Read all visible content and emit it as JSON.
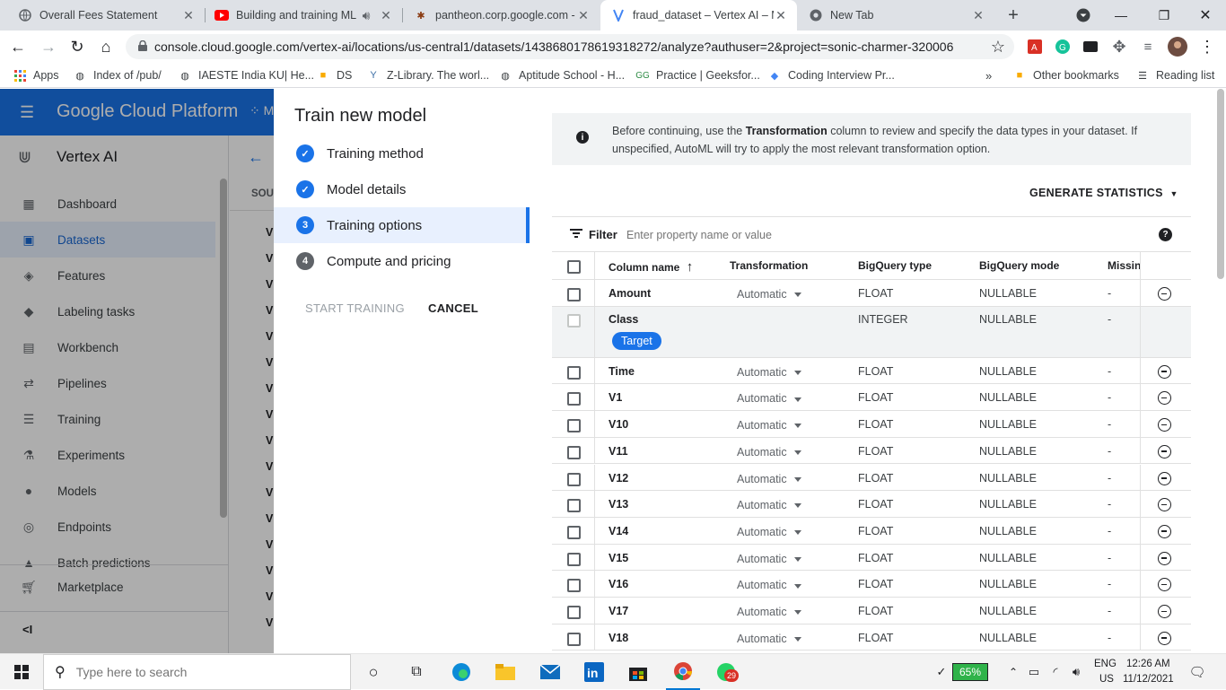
{
  "browser": {
    "tabs": [
      {
        "title": "Overall Fees Statement",
        "icon": "globe-icon"
      },
      {
        "title": "Building and training ML",
        "icon": "youtube-icon",
        "audio": true
      },
      {
        "title": "pantheon.corp.google.com -",
        "icon": "bug-icon"
      },
      {
        "title": "fraud_dataset – Vertex AI – M",
        "icon": "vertex-icon",
        "active": true
      },
      {
        "title": "New Tab",
        "icon": "chrome-icon"
      }
    ],
    "url": "console.cloud.google.com/vertex-ai/locations/us-central1/datasets/1438680178619318272/analyze?authuser=2&project=sonic-charmer-320006",
    "bookmarks": [
      {
        "label": "Apps"
      },
      {
        "label": "Index of /pub/"
      },
      {
        "label": "IAESTE India KU| He..."
      },
      {
        "label": "DS"
      },
      {
        "label": "Z-Library. The worl..."
      },
      {
        "label": "Aptitude School - H..."
      },
      {
        "label": "Practice | Geeksfor..."
      },
      {
        "label": "Coding Interview Pr..."
      },
      {
        "label": "»"
      },
      {
        "label": "Other bookmarks"
      },
      {
        "label": "Reading list"
      }
    ]
  },
  "console": {
    "product": "Google Cloud Platform",
    "project_initial": "M",
    "service": "Vertex AI",
    "nav": [
      {
        "label": "Dashboard",
        "icon": "dashboard-icon"
      },
      {
        "label": "Datasets",
        "icon": "datasets-icon",
        "selected": true
      },
      {
        "label": "Features",
        "icon": "features-icon"
      },
      {
        "label": "Labeling tasks",
        "icon": "label-icon"
      },
      {
        "label": "Workbench",
        "icon": "workbench-icon"
      },
      {
        "label": "Pipelines",
        "icon": "pipelines-icon"
      },
      {
        "label": "Training",
        "icon": "training-icon"
      },
      {
        "label": "Experiments",
        "icon": "experiments-icon"
      },
      {
        "label": "Models",
        "icon": "models-icon"
      },
      {
        "label": "Endpoints",
        "icon": "endpoints-icon"
      },
      {
        "label": "Batch predictions",
        "icon": "batch-icon"
      }
    ],
    "marketplace": "Marketplace",
    "bg_column_header": "SOU",
    "bg_rows": [
      "V",
      "V",
      "V",
      "V",
      "V",
      "V",
      "V",
      "V",
      "V",
      "V",
      "V",
      "V",
      "V",
      "V",
      "V",
      "V"
    ]
  },
  "panel": {
    "title": "Train new model",
    "steps": [
      {
        "label": "Training method",
        "state": "done"
      },
      {
        "label": "Model details",
        "state": "done"
      },
      {
        "label": "Training options",
        "state": "current",
        "number": "3"
      },
      {
        "label": "Compute and pricing",
        "state": "todo",
        "number": "4"
      }
    ],
    "start_training": "START TRAINING",
    "cancel": "CANCEL"
  },
  "main": {
    "info_pre": "Before continuing, use the ",
    "info_bold": "Transformation",
    "info_post": " column to review and specify the data types in your dataset. If unspecified, AutoML will try to apply the most relevant transformation option.",
    "generate_stats": "GENERATE STATISTICS",
    "filter_label": "Filter",
    "filter_placeholder": "Enter property name or value",
    "columns": {
      "name": "Column name",
      "transformation": "Transformation",
      "bq_type": "BigQuery type",
      "bq_mode": "BigQuery mode",
      "missing": "Missin"
    },
    "rows": [
      {
        "name": "Amount",
        "transformation": "Automatic",
        "type": "FLOAT",
        "mode": "NULLABLE",
        "missing": "-"
      },
      {
        "name": "Class",
        "transformation": "",
        "type": "INTEGER",
        "mode": "NULLABLE",
        "missing": "-",
        "target": "Target"
      },
      {
        "name": "Time",
        "transformation": "Automatic",
        "type": "FLOAT",
        "mode": "NULLABLE",
        "missing": "-"
      },
      {
        "name": "V1",
        "transformation": "Automatic",
        "type": "FLOAT",
        "mode": "NULLABLE",
        "missing": "-"
      },
      {
        "name": "V10",
        "transformation": "Automatic",
        "type": "FLOAT",
        "mode": "NULLABLE",
        "missing": "-"
      },
      {
        "name": "V11",
        "transformation": "Automatic",
        "type": "FLOAT",
        "mode": "NULLABLE",
        "missing": "-"
      },
      {
        "name": "V12",
        "transformation": "Automatic",
        "type": "FLOAT",
        "mode": "NULLABLE",
        "missing": "-"
      },
      {
        "name": "V13",
        "transformation": "Automatic",
        "type": "FLOAT",
        "mode": "NULLABLE",
        "missing": "-"
      },
      {
        "name": "V14",
        "transformation": "Automatic",
        "type": "FLOAT",
        "mode": "NULLABLE",
        "missing": "-"
      },
      {
        "name": "V15",
        "transformation": "Automatic",
        "type": "FLOAT",
        "mode": "NULLABLE",
        "missing": "-"
      },
      {
        "name": "V16",
        "transformation": "Automatic",
        "type": "FLOAT",
        "mode": "NULLABLE",
        "missing": "-"
      },
      {
        "name": "V17",
        "transformation": "Automatic",
        "type": "FLOAT",
        "mode": "NULLABLE",
        "missing": "-"
      },
      {
        "name": "V18",
        "transformation": "Automatic",
        "type": "FLOAT",
        "mode": "NULLABLE",
        "missing": "-"
      }
    ]
  },
  "taskbar": {
    "search_placeholder": "Type here to search",
    "battery": "65%",
    "language": "ENG",
    "region": "US",
    "time": "12:26 AM",
    "date": "11/12/2021",
    "whatsapp_badge": "29"
  },
  "colors": {
    "gcp_blue": "#1a73e8",
    "tab_strip": "#dee1e6",
    "selected_nav": "#e8f0fe"
  }
}
